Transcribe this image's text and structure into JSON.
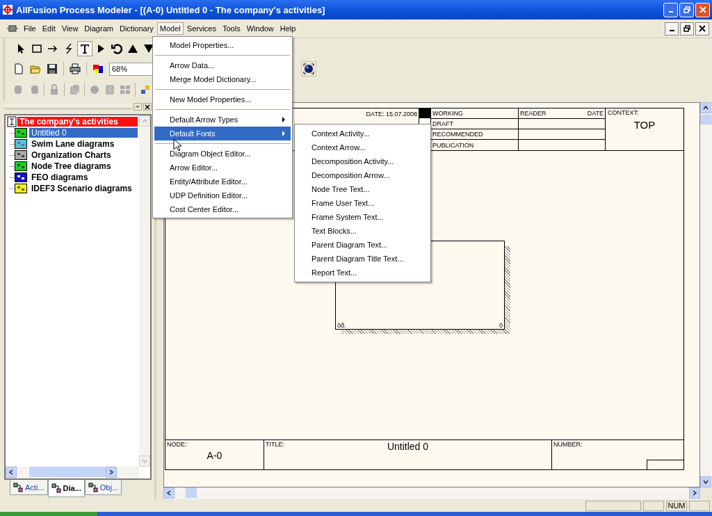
{
  "window": {
    "title": "AllFusion Process Modeler - [(A-0) Untitled 0 - The company's activities]"
  },
  "menu_bar": [
    {
      "label": "File",
      "selected": false
    },
    {
      "label": "Edit",
      "selected": false
    },
    {
      "label": "View",
      "selected": false
    },
    {
      "label": "Diagram",
      "selected": false
    },
    {
      "label": "Dictionary",
      "selected": false
    },
    {
      "label": "Model",
      "selected": true
    },
    {
      "label": "Services",
      "selected": false
    },
    {
      "label": "Tools",
      "selected": false
    },
    {
      "label": "Window",
      "selected": false
    },
    {
      "label": "Help",
      "selected": false
    }
  ],
  "tools": [
    {
      "kind": "pointer",
      "selected": false
    },
    {
      "kind": "rect",
      "selected": false
    },
    {
      "kind": "arrow",
      "selected": false
    },
    {
      "kind": "squiggle",
      "selected": false
    },
    {
      "kind": "text",
      "selected": true
    },
    {
      "kind": "play",
      "selected": false
    },
    {
      "kind": "undo",
      "selected": false
    },
    {
      "kind": "up",
      "selected": false
    },
    {
      "kind": "down",
      "selected": false
    }
  ],
  "zoom_field": {
    "value": "68%"
  },
  "model_menu": {
    "groups": [
      [
        {
          "label": "Model Properties...",
          "kind": "item",
          "selected": false
        }
      ],
      [
        {
          "label": "Arrow Data...",
          "kind": "item",
          "selected": false
        },
        {
          "label": "Merge Model Dictionary...",
          "kind": "item",
          "selected": false
        }
      ],
      [
        {
          "label": "New Model Properties...",
          "kind": "item",
          "selected": false
        }
      ],
      [
        {
          "label": "Default Arrow Types",
          "kind": "submenu",
          "selected": false
        },
        {
          "label": "Default Fonts",
          "kind": "submenu",
          "selected": true
        }
      ],
      [
        {
          "label": "Diagram Object Editor...",
          "kind": "item",
          "selected": false
        },
        {
          "label": "Arrow Editor...",
          "kind": "item",
          "selected": false
        },
        {
          "label": "Entity/Attribute Editor...",
          "kind": "item",
          "selected": false
        },
        {
          "label": "UDP Definition Editor...",
          "kind": "item",
          "selected": false
        },
        {
          "label": "Cost Center Editor...",
          "kind": "item",
          "selected": false
        }
      ]
    ]
  },
  "fonts_submenu": [
    "Context Activity...",
    "Context Arrow...",
    "Decomposition Activity...",
    "Decomposition Arrow...",
    "Node Tree Text...",
    "Frame User Text...",
    "Frame System Text...",
    "Text Blocks...",
    "Parent Diagram Text...",
    "Parent Diagram Title Text...",
    "Report Text..."
  ],
  "model_tree": {
    "root": "The company's activities",
    "children": [
      {
        "label": "Untitled 0",
        "kind": "idef0",
        "selected": true
      },
      {
        "label": "Swim Lane diagrams",
        "kind": "swimlane",
        "selected": false
      },
      {
        "label": "Organization Charts",
        "kind": "orgchart",
        "selected": false
      },
      {
        "label": "Node Tree diagrams",
        "kind": "nodetree",
        "selected": false
      },
      {
        "label": "FEO diagrams",
        "kind": "feo",
        "selected": false
      },
      {
        "label": "IDEF3 Scenario diagrams",
        "kind": "idef3",
        "selected": false
      }
    ]
  },
  "panel_tabs": [
    {
      "label": "Acti...",
      "selected": false
    },
    {
      "label": "Dia...",
      "selected": true
    },
    {
      "label": "Obj...",
      "selected": false
    }
  ],
  "diagram": {
    "header": {
      "date": "DATE: 15.07.2008",
      "status": [
        "WORKING",
        "DRAFT",
        "RECOMMENDED",
        "PUBLICATION"
      ],
      "reader": "READER",
      "reader_date": "DATE",
      "context": "CONTEXT:",
      "context_value": "TOP"
    },
    "activity": {
      "cost": "0ð.",
      "number": "0"
    },
    "footer": {
      "node": "NODE:",
      "node_value": "A-0",
      "title": "TITLE:",
      "title_value": "Untitled 0",
      "number": "NUMBER:"
    }
  },
  "status_bar": {
    "num": "NUM"
  }
}
